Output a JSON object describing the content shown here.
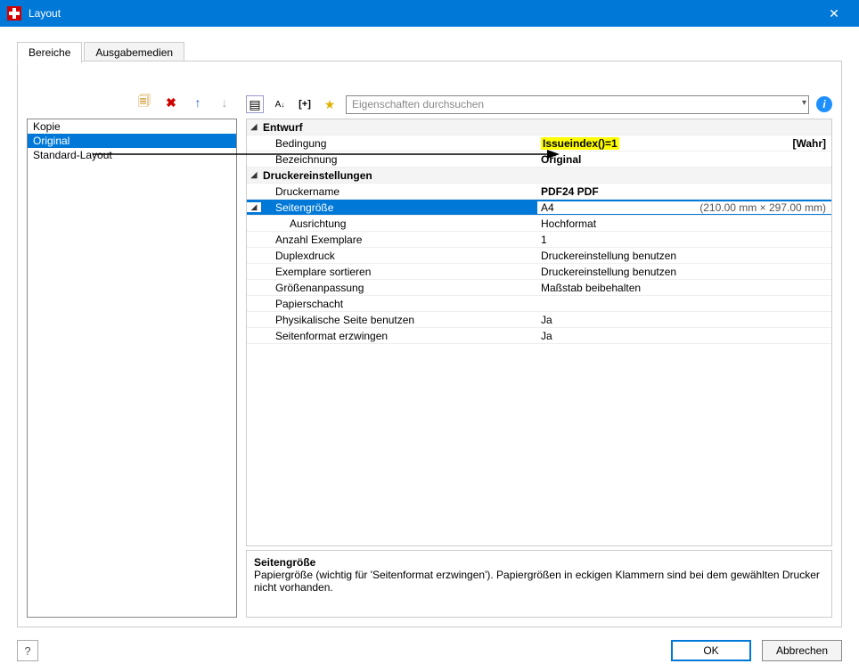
{
  "window": {
    "title": "Layout"
  },
  "tabs": {
    "active": "Bereiche",
    "inactive": "Ausgabemedien"
  },
  "leftlist": {
    "items": [
      "Kopie",
      "Original",
      "Standard-Layout"
    ],
    "selectedIndex": 1
  },
  "lefttools": {
    "copy": "copy-icon",
    "delete": "delete-icon",
    "up": "up-icon",
    "down": "down-icon"
  },
  "righttools": {
    "cat": "categorize-icon",
    "sort": "sort-icon",
    "add": "[+]",
    "star": "star-icon",
    "searchPlaceholder": "Eigenschaften durchsuchen",
    "info": "info-icon"
  },
  "props": {
    "cat1": "Entwurf",
    "bedingung_label": "Bedingung",
    "bedingung_val": "Issueindex()=1",
    "bedingung_extra": "[Wahr]",
    "bezeichnung_label": "Bezeichnung",
    "bezeichnung_val": "Original",
    "cat2": "Druckereinstellungen",
    "druckername_label": "Druckername",
    "druckername_val": "PDF24 PDF",
    "seitengroesse_label": "Seitengröße",
    "seitengroesse_val": "A4",
    "seitengroesse_dim": "(210.00 mm × 297.00 mm)",
    "ausrichtung_label": "Ausrichtung",
    "ausrichtung_val": "Hochformat",
    "anzahl_label": "Anzahl Exemplare",
    "anzahl_val": "1",
    "duplex_label": "Duplexdruck",
    "duplex_val": "Druckereinstellung benutzen",
    "sortieren_label": "Exemplare sortieren",
    "sortieren_val": "Druckereinstellung benutzen",
    "groessen_label": "Größenanpassung",
    "groessen_val": "Maßstab beibehalten",
    "schacht_label": "Papierschacht",
    "schacht_val": "",
    "physseite_label": "Physikalische Seite benutzen",
    "physseite_val": "Ja",
    "seitfmt_label": "Seitenformat erzwingen",
    "seitfmt_val": "Ja"
  },
  "desc": {
    "title": "Seitengröße",
    "text": "Papiergröße (wichtig für 'Seitenformat erzwingen'). Papiergrößen in eckigen Klammern sind bei dem gewählten Drucker nicht vorhanden."
  },
  "footer": {
    "ok": "OK",
    "cancel": "Abbrechen",
    "help": "?"
  }
}
